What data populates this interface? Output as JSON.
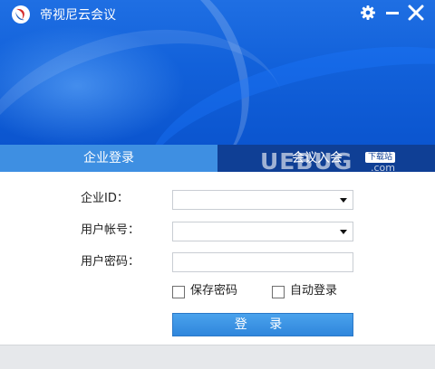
{
  "window": {
    "title": "帝视尼云会议"
  },
  "titlebar_icons": [
    "gear-icon",
    "minimize-icon",
    "close-icon"
  ],
  "tabs": [
    {
      "label": "企业登录",
      "active": true
    },
    {
      "label": "会议入会",
      "active": false
    }
  ],
  "form": {
    "enterprise_id": {
      "label": "企业ID：",
      "value": ""
    },
    "account": {
      "label": "用户帐号：",
      "value": ""
    },
    "password": {
      "label": "用户密码：",
      "value": ""
    },
    "save_password": {
      "label": "保存密码",
      "checked": false
    },
    "auto_login": {
      "label": "自动登录",
      "checked": false
    },
    "login_button": "登 录"
  },
  "watermark": {
    "text": "UEBUG",
    "badge": "下载站",
    "domain": ".com"
  },
  "colors": {
    "banner": "#1261da",
    "tab_active": "#3e8fe2",
    "tab_inactive": "#0f3f95",
    "button": "#3a92e3",
    "footer": "#e6e8eb"
  }
}
